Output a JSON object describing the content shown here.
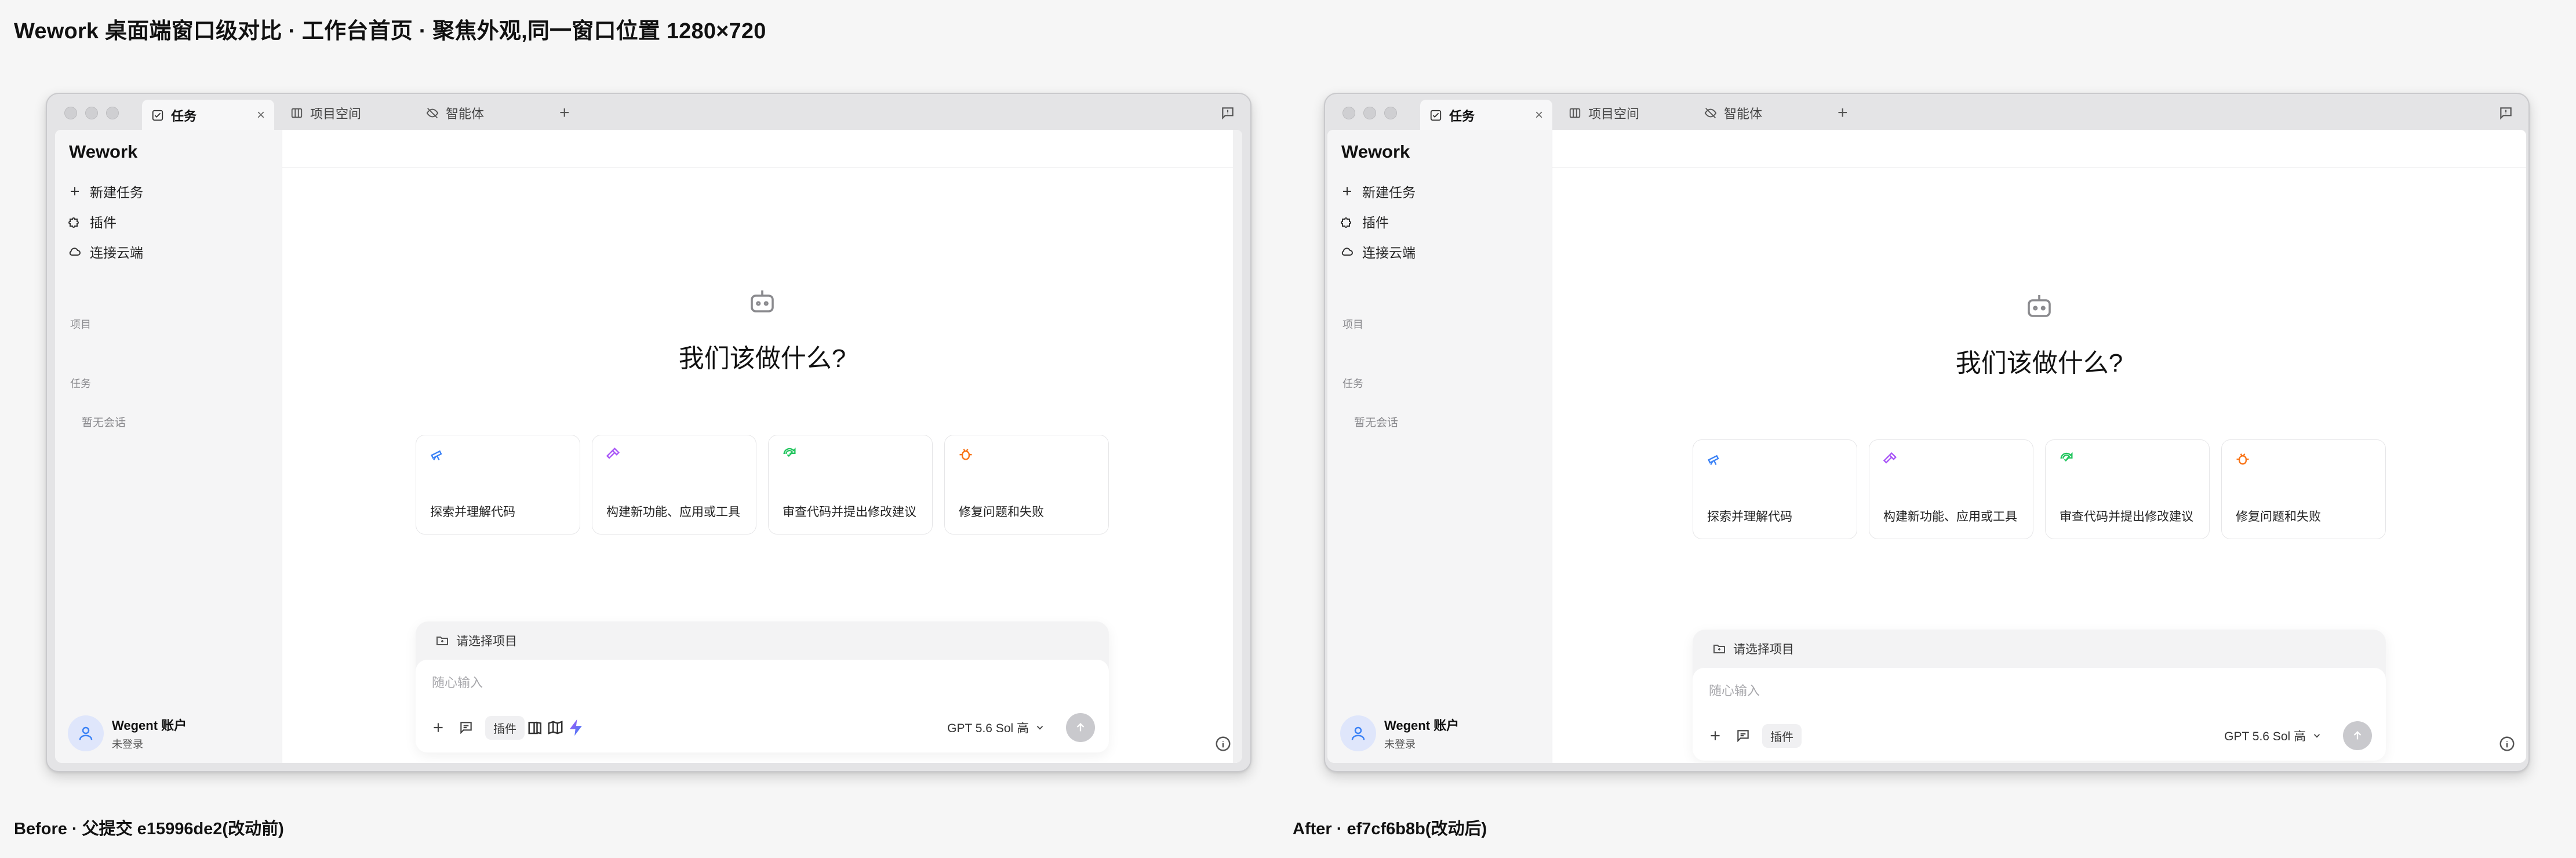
{
  "page_title": "Wework 桌面端窗口级对比 · 工作台首页 · 聚焦外观,同一窗口位置 1280×720",
  "captions": {
    "before": "Before · 父提交 e15996de2(改动前)",
    "after": "After · ef7cf6b8b(改动后)"
  },
  "window": {
    "tabs": [
      {
        "label": "任务",
        "icon": "task-check-icon",
        "close": "×"
      },
      {
        "label": "项目空间",
        "icon": "grid-icon"
      },
      {
        "label": "智能体",
        "icon": "agent-eye-off-icon"
      }
    ],
    "new_tab": "+",
    "brand": "Wework",
    "menu": [
      {
        "label": "新建任务",
        "icon": "plus-icon"
      },
      {
        "label": "插件",
        "icon": "puzzle-icon"
      },
      {
        "label": "连接云端",
        "icon": "cloud-icon"
      }
    ],
    "section_project": "项目",
    "section_task": "任务",
    "empty_sessions": "暂无会话",
    "account_name": "Wegent 账户",
    "account_status": "未登录",
    "headline": "我们该做什么?",
    "cards": [
      {
        "label": "探索并理解代码",
        "icon": "telescope-icon",
        "color": "#3b82f6"
      },
      {
        "label": "构建新功能、应用或工具",
        "icon": "hammer-icon",
        "color": "#a855f7"
      },
      {
        "label": "审查代码并提出修改建议",
        "icon": "review-icon",
        "color": "#22c55e"
      },
      {
        "label": "修复问题和失败",
        "icon": "bug-icon",
        "color": "#f97316"
      }
    ],
    "select_project": "请选择项目",
    "input_placeholder": "随心输入",
    "plugin_label": "插件",
    "model_label": "GPT 5.6 Sol 高"
  },
  "colors": {
    "accent_blue": "#3b82f6",
    "plugin_gradient_start": "#a855f7",
    "plugin_gradient_end": "#3b82f6"
  }
}
